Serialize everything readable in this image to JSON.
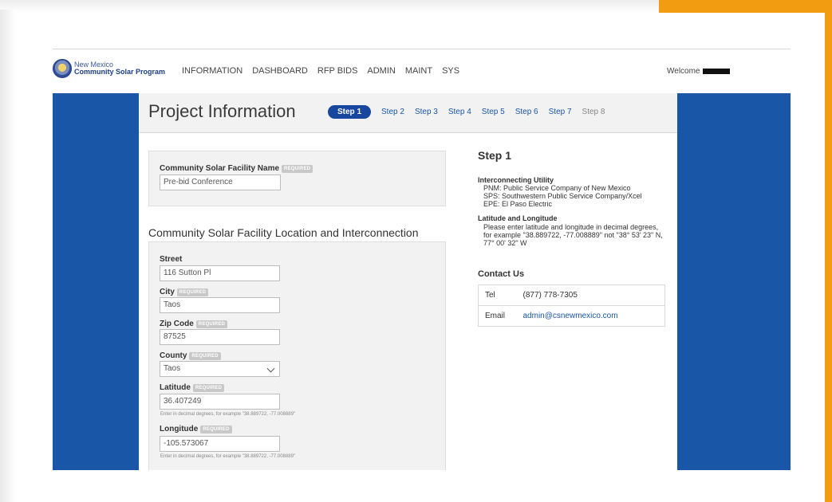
{
  "brand": {
    "line1": "New Mexico",
    "line2": "Community Solar Program",
    "seal_icon": "nm-state-seal"
  },
  "nav": {
    "items": [
      "INFORMATION",
      "DASHBOARD",
      "RFP BIDS",
      "ADMIN",
      "MAINT",
      "SYS"
    ]
  },
  "user": {
    "welcome_label": "Welcome"
  },
  "header": {
    "title": "Project Information",
    "steps": [
      {
        "label": "Step 1",
        "state": "active"
      },
      {
        "label": "Step 2",
        "state": "link"
      },
      {
        "label": "Step 3",
        "state": "link"
      },
      {
        "label": "Step 4",
        "state": "link"
      },
      {
        "label": "Step 5",
        "state": "link"
      },
      {
        "label": "Step 6",
        "state": "link"
      },
      {
        "label": "Step 7",
        "state": "link"
      },
      {
        "label": "Step 8",
        "state": "disabled"
      }
    ]
  },
  "form": {
    "required_badge": "REQUIRED",
    "facility_name": {
      "label": "Community Solar Facility Name",
      "value": "Pre-bid Conference"
    },
    "location_section_title": "Community Solar Facility Location and Interconnection",
    "street": {
      "label": "Street",
      "value": "116 Sutton Pl"
    },
    "city": {
      "label": "City",
      "value": "Taos"
    },
    "zip": {
      "label": "Zip Code",
      "value": "87525"
    },
    "county": {
      "label": "County",
      "value": "Taos"
    },
    "latitude": {
      "label": "Latitude",
      "value": "36.407249",
      "hint": "Enter in decimal degrees, for example \"38.889722, -77.008889\""
    },
    "longitude": {
      "label": "Longitude",
      "value": "-105.573067",
      "hint": "Enter in decimal degrees, for example \"38.889722, -77.008889\""
    }
  },
  "sidebar": {
    "heading": "Step 1",
    "utility_heading": "Interconnecting Utility",
    "utilities": [
      "PNM: Public Service Company of New Mexico",
      "SPS: Southwestern Public Service Company/Xcel",
      "EPE: El Paso Electric"
    ],
    "latlong_heading": "Latitude and Longitude",
    "latlong_text": "Please enter latitude and longitude in decimal degrees, for example \"38.889722, -77.008889\" not \"38° 53' 23\" N, 77° 00' 32\" W",
    "contact_heading": "Contact Us",
    "contacts": [
      {
        "key": "Tel",
        "value": "(877) 778-7305"
      },
      {
        "key": "Email",
        "value": "admin@csnewmexico.com"
      }
    ]
  },
  "colors": {
    "accent_orange": "#f29c11",
    "brand_blue": "#1a56a7",
    "active_step": "#17479e"
  }
}
